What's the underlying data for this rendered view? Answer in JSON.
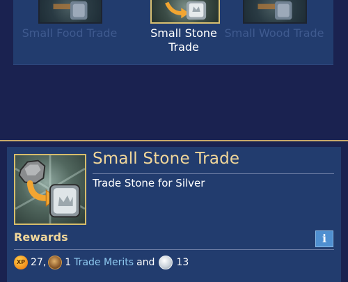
{
  "trades": [
    {
      "label": "Small Food Trade",
      "state": "dimmed"
    },
    {
      "label": "Small Stone Trade",
      "state": "selected"
    },
    {
      "label": "Small Wood Trade",
      "state": "dimmed"
    }
  ],
  "detail": {
    "title": "Small Stone Trade",
    "description": "Trade Stone for Silver",
    "rewards_label": "Rewards",
    "info_label": "i",
    "rewards": {
      "xp_icon_text": "XP",
      "xp_value": "27,",
      "merits_value": "1",
      "merits_label": "Trade Merits",
      "and_text": "and",
      "silver_value": "13"
    }
  },
  "icons": [
    "stone-to-silver-trade-icon",
    "xp-icon",
    "trade-merit-icon",
    "silver-coin-icon",
    "info-icon"
  ],
  "colors": {
    "title_gold": "#f1d79a",
    "link_blue": "#8ec9f0",
    "panel_blue": "#223c6e",
    "background": "#1a2250"
  }
}
